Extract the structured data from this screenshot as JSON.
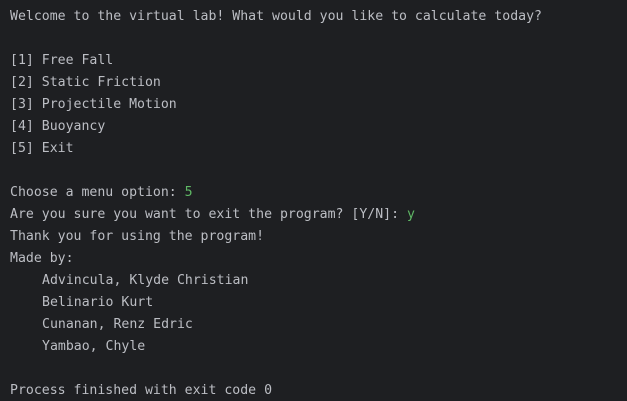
{
  "console": {
    "welcome": "Welcome to the virtual lab! What would you like to calculate today?",
    "menu": [
      "[1] Free Fall",
      "[2] Static Friction",
      "[3] Projectile Motion",
      "[4] Buoyancy",
      "[5] Exit"
    ],
    "prompt_menu": "Choose a menu option: ",
    "input_menu": "5",
    "prompt_exit": "Are you sure you want to exit the program? [Y/N]: ",
    "input_exit": "y",
    "thanks": "Thank you for using the program!",
    "made_by": "Made by:",
    "authors": [
      "Advincula, Klyde Christian",
      "Belinario Kurt",
      "Cunanan, Renz Edric",
      "Yambao, Chyle"
    ],
    "exit_message": "Process finished with exit code 0"
  },
  "colors": {
    "background": "#1e1f22",
    "text": "#bcbec4",
    "user_input": "#5fb865"
  }
}
